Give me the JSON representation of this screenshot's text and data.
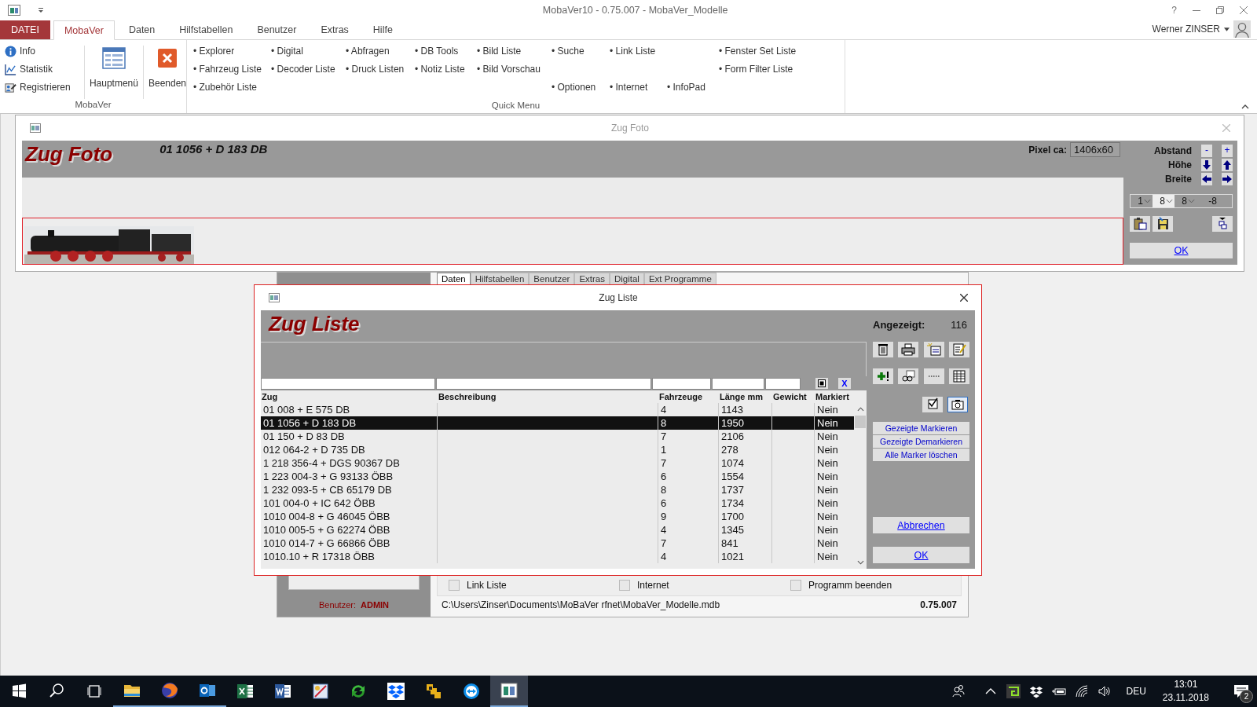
{
  "app_window": {
    "title": "MobaVer10 - 0.75.007 - MobaVer_Modelle",
    "help": "?"
  },
  "ribbon": {
    "tabs": [
      {
        "label": "DATEI",
        "kind": "file",
        "selected": false
      },
      {
        "label": "MobaVer",
        "kind": "tab",
        "selected": true
      },
      {
        "label": "Daten",
        "kind": "tab",
        "selected": false
      },
      {
        "label": "Hilfstabellen",
        "kind": "tab",
        "selected": false
      },
      {
        "label": "Benutzer",
        "kind": "tab",
        "selected": false
      },
      {
        "label": "Extras",
        "kind": "tab",
        "selected": false
      },
      {
        "label": "Hilfe",
        "kind": "tab",
        "selected": false
      }
    ],
    "user": "Werner ZINSER",
    "mobaver_group": {
      "label": "MobaVer",
      "small_items": [
        {
          "label": "Info",
          "kind": "info"
        },
        {
          "label": "Statistik",
          "kind": "chart"
        },
        {
          "label": "Registrieren",
          "kind": "register"
        }
      ],
      "large_items": [
        {
          "label": "Hauptmenü",
          "kind": "form"
        },
        {
          "label": "Beenden",
          "kind": "exit"
        }
      ]
    },
    "quick_menu": {
      "label": "Quick Menu",
      "bullet": "•",
      "columns": [
        [
          "Explorer",
          "Fahrzeug Liste",
          "Zubehör Liste"
        ],
        [
          "Digital",
          "Decoder Liste",
          null
        ],
        [
          "Abfragen",
          "Druck Listen",
          null
        ],
        [
          "DB Tools",
          "Notiz Liste",
          null
        ],
        [
          "Bild Liste",
          "Bild Vorschau",
          null
        ],
        [
          "Suche",
          null,
          "Optionen"
        ],
        [
          "Link Liste",
          null,
          "Internet"
        ],
        [
          null,
          null,
          "InfoPad"
        ],
        [
          "Fenster Set Liste",
          "Form Filter Liste",
          null
        ]
      ]
    }
  },
  "zug_foto": {
    "title": "Zug Foto",
    "heading": "Zug Foto",
    "train": "01 1056 + D 183 DB",
    "pixel_label": "Pixel ca:",
    "pixel_value": "1406x60",
    "adjust_rows": [
      {
        "label": "Abstand",
        "kind": "text",
        "buttons": [
          "-",
          "+"
        ]
      },
      {
        "label": "Höhe",
        "kind": "vertical"
      },
      {
        "label": "Breite",
        "kind": "horizontal"
      }
    ],
    "selects": [
      {
        "value": "1",
        "kind": "dropdown"
      },
      {
        "value": "8",
        "kind": "dropdown"
      },
      {
        "value": "8",
        "kind": "dropdown"
      },
      {
        "value": "-8",
        "kind": "plain"
      }
    ],
    "ok": "OK"
  },
  "main_form": {
    "tabs": [
      {
        "label": "Daten",
        "selected": true
      },
      {
        "label": "Hilfstabellen",
        "selected": false
      },
      {
        "label": "Benutzer",
        "selected": false
      },
      {
        "label": "Extras",
        "selected": false
      },
      {
        "label": "Digital",
        "selected": false
      },
      {
        "label": "Ext Programme",
        "selected": false
      }
    ],
    "checkboxes": [
      {
        "label": "Link Liste",
        "checked": false
      },
      {
        "label": "Internet",
        "checked": false
      },
      {
        "label": "Programm beenden",
        "checked": false
      }
    ],
    "user_label": "Benutzer:",
    "user": "ADMIN",
    "path": "C:\\Users\\Zinser\\Documents\\MoBaVer rfnet\\MobaVer_Modelle.mdb",
    "version": "0.75.007"
  },
  "zug_liste": {
    "title": "Zug Liste",
    "heading": "Zug Liste",
    "count_label": "Angezeigt:",
    "count": "116",
    "filter_clear": "X",
    "columns": [
      "Zug",
      "Beschreibung",
      "Fahrzeuge",
      "Länge mm",
      "Gewicht",
      "Markiert"
    ],
    "rows": [
      {
        "zug": "01 008 + E 575 DB",
        "fahrzeuge": "4",
        "laenge": "1143",
        "markiert": "Nein",
        "selected": false
      },
      {
        "zug": "01 1056 + D 183 DB",
        "fahrzeuge": "8",
        "laenge": "1950",
        "markiert": "Nein",
        "selected": true
      },
      {
        "zug": "01 150 + D 83 DB",
        "fahrzeuge": "7",
        "laenge": "2106",
        "markiert": "Nein",
        "selected": false
      },
      {
        "zug": "012 064-2 + D 735 DB",
        "fahrzeuge": "1",
        "laenge": "278",
        "markiert": "Nein",
        "selected": false
      },
      {
        "zug": "1 218 356-4 + DGS 90367 DB",
        "fahrzeuge": "7",
        "laenge": "1074",
        "markiert": "Nein",
        "selected": false
      },
      {
        "zug": "1 223 004-3 + G 93133 ÖBB",
        "fahrzeuge": "6",
        "laenge": "1554",
        "markiert": "Nein",
        "selected": false
      },
      {
        "zug": "1 232 093-5 + CB 65179 DB",
        "fahrzeuge": "8",
        "laenge": "1737",
        "markiert": "Nein",
        "selected": false
      },
      {
        "zug": "101 004-0 + IC 642 ÖBB",
        "fahrzeuge": "6",
        "laenge": "1734",
        "markiert": "Nein",
        "selected": false
      },
      {
        "zug": "1010 004-8 + G 46045 ÖBB",
        "fahrzeuge": "9",
        "laenge": "1700",
        "markiert": "Nein",
        "selected": false
      },
      {
        "zug": "1010 005-5 + G 62274 ÖBB",
        "fahrzeuge": "4",
        "laenge": "1345",
        "markiert": "Nein",
        "selected": false
      },
      {
        "zug": "1010 014-7 + G 66866 ÖBB",
        "fahrzeuge": "7",
        "laenge": "841",
        "markiert": "Nein",
        "selected": false
      },
      {
        "zug": "1010.10 + R 17318 ÖBB",
        "fahrzeuge": "4",
        "laenge": "1021",
        "markiert": "Nein",
        "selected": false
      }
    ],
    "link_buttons": [
      "Gezeigte Markieren",
      "Gezeigte Demarkieren",
      "Alle Marker löschen"
    ],
    "cancel": "Abbrechen",
    "ok": "OK"
  },
  "taskbar": {
    "apps": [
      {
        "kind": "folder",
        "running": true,
        "active": false
      },
      {
        "kind": "browser",
        "running": true,
        "active": false
      },
      {
        "kind": "mail",
        "running": true,
        "active": false
      },
      {
        "kind": "sheet",
        "running": false,
        "active": false
      },
      {
        "kind": "doc",
        "running": false,
        "active": false
      },
      {
        "kind": "draw",
        "running": false,
        "active": false
      },
      {
        "kind": "sync",
        "running": false,
        "active": false
      },
      {
        "kind": "box",
        "running": false,
        "active": false
      },
      {
        "kind": "puzzle",
        "running": false,
        "active": false
      },
      {
        "kind": "remote",
        "running": false,
        "active": false
      },
      {
        "kind": "window",
        "running": true,
        "active": true
      }
    ],
    "language": "DEU",
    "time": "13:01",
    "date": "23.11.2018",
    "notifications": "2"
  }
}
